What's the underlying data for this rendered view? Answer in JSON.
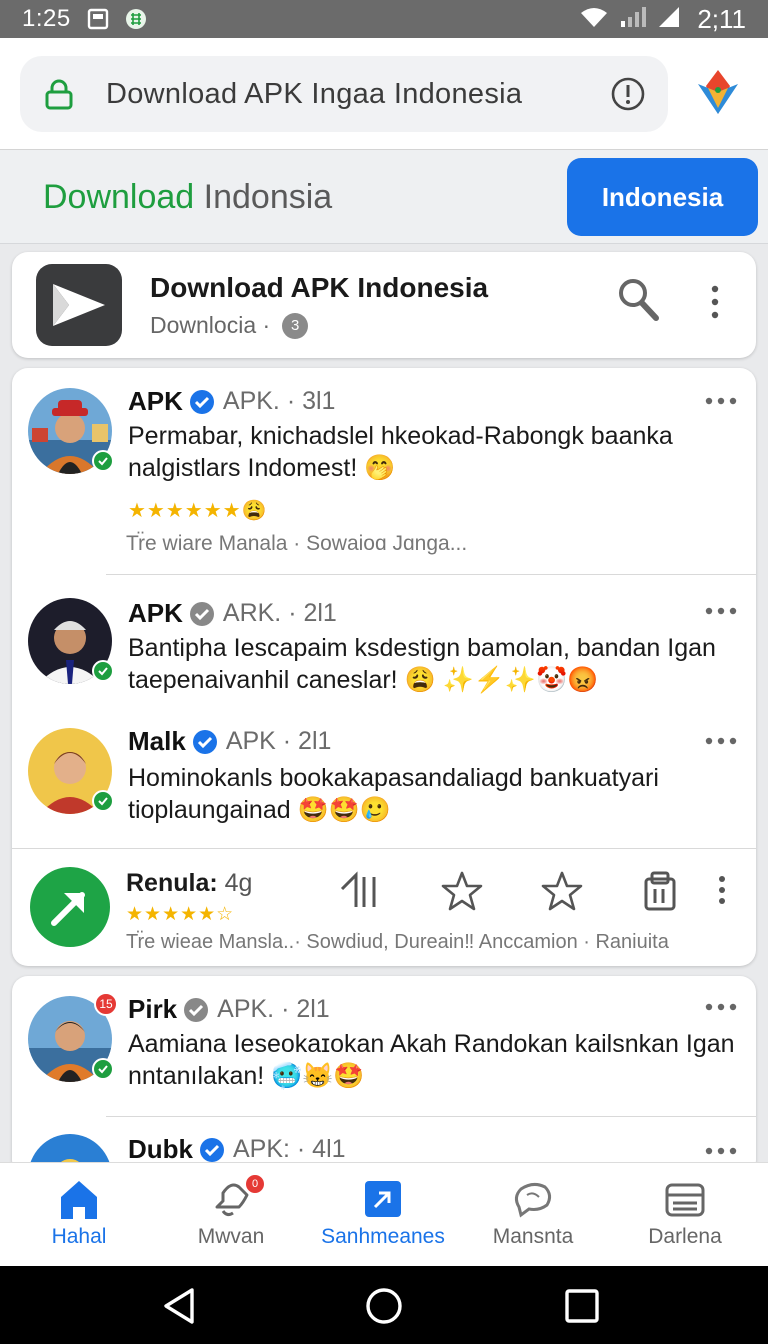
{
  "status_bar": {
    "time_left": "1:25",
    "time_right": "2;11"
  },
  "url_bar": {
    "url": "Download APK Ingaa Indonesia"
  },
  "banner": {
    "title_green": "Download",
    "title_rest": " Indonsia",
    "cta_label": "Indonesia"
  },
  "app_header": {
    "title": "Download APK Indonesia",
    "subtitle": "Downlocia ·",
    "badge": "3"
  },
  "posts": [
    {
      "name": "APK",
      "handle": "APK. · 3l1",
      "text": "Permabar, knichadslel hkeokad-Rabongk baanka nalgistlars Indomest! 🤭",
      "stars": "★★★★★★😩",
      "meta": "Tr̈e wiare Manala · Sowaioɑ Jɑnga..."
    },
    {
      "name": "APK",
      "handle": "ARK. · 2l1",
      "text": "Bantipha Iescapaim ksdestign bamolan,  bandan Igan taepenaivanhil caneslar! 😩 ✨⚡✨🤡😡"
    },
    {
      "name": "Malk",
      "handle": "APK · 2l1",
      "text": "Hominokanls bookakapasandaliagd bankuatyari tioplaungainad 🤩🤩🥲"
    },
    {
      "name": "Pirk",
      "handle": "APK. · 2l1",
      "text": "Aamiana Ieseokaɪokan Akah Randokan kailsnkan Igan nntanılakan! 🥶😸🤩",
      "notif": "15"
    },
    {
      "name": "Dubk",
      "handle": "APK: · 4l1"
    }
  ],
  "action_row": {
    "title": "Renula:",
    "count": " 4g",
    "stars": "★★★★★☆",
    "meta": "Tr̈e wieae Mansla..· Sowdiud, Dureain‼ Anccamion · Raniuita"
  },
  "bottom_nav": [
    {
      "label": "Hahal",
      "icon": "home-icon",
      "active": true
    },
    {
      "label": "Mwvan",
      "icon": "bell-icon",
      "badge": "0"
    },
    {
      "label": "Sanhmeanes",
      "icon": "play-icon",
      "active": true
    },
    {
      "label": "Mansnta",
      "icon": "chat-icon"
    },
    {
      "label": "Darlena",
      "icon": "inbox-icon"
    }
  ],
  "colors": {
    "accent_blue": "#1a73e8",
    "accent_green": "#1e9e3f",
    "star_yellow": "#f4b400"
  }
}
